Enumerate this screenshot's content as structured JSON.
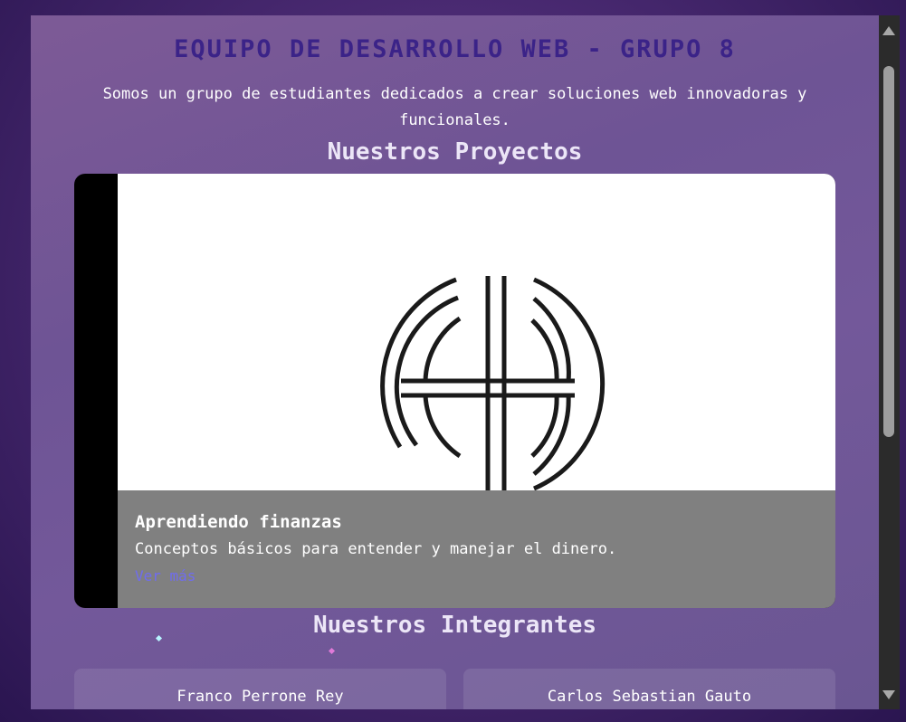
{
  "header": {
    "title": "EQUIPO DE DESARROLLO WEB - GRUPO 8",
    "subtitle": "Somos un grupo de estudiantes dedicados a crear soluciones web innovadoras y funcionales."
  },
  "projects": {
    "section_title": "Nuestros Proyectos",
    "items": [
      {
        "title": "Aprendiendo finanzas",
        "description": "Conceptos básicos para entender y manejar el dinero.",
        "link_label": "Ver más",
        "image_icon": "abstract-circle-logo-icon"
      }
    ]
  },
  "members": {
    "section_title": "Nuestros Integrantes",
    "items": [
      {
        "name": "Franco Perrone Rey"
      },
      {
        "name": "Carlos Sebastian Gauto"
      }
    ]
  },
  "colors": {
    "title": "#3b2388",
    "link": "#6f6cf0",
    "caption_bg": "#808080"
  }
}
